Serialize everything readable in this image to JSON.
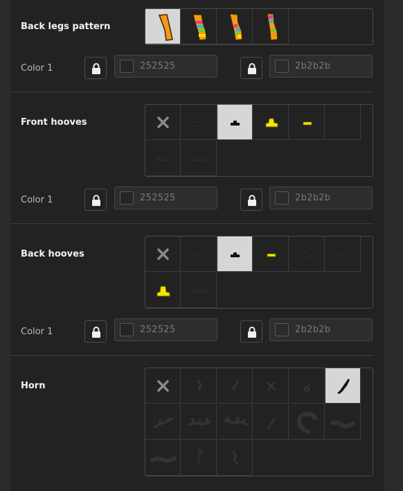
{
  "colors": {
    "accent_selected": "#d6d6d6",
    "panel_bg": "#222222",
    "page_bg": "#2b2b2b"
  },
  "sections": {
    "back_legs_pattern": {
      "label": "Back legs pattern",
      "options": [
        "solid-orange-leg-icon",
        "rainbow-stripe-leg-icon",
        "rainbow-patch-leg-icon",
        "rainbow-sock-leg-icon"
      ],
      "selected_index": 0,
      "color_label": "Color 1",
      "color_a": {
        "hex": "252525",
        "swatch": "#252525"
      },
      "color_b": {
        "hex": "2b2b2b",
        "swatch": "#2b2b2b"
      }
    },
    "front_hooves": {
      "label": "Front hooves",
      "options": [
        "none-x-icon",
        "hoof-style-1-icon",
        "hoof-style-2-icon",
        "golden-hoof-icon",
        "yellow-hoof-band-icon",
        "hoof-style-5-icon",
        "hoof-style-6-icon",
        "hoof-style-7-icon"
      ],
      "selected_index": 2,
      "color_label": "Color 1",
      "color_a": {
        "hex": "252525",
        "swatch": "#252525"
      },
      "color_b": {
        "hex": "2b2b2b",
        "swatch": "#2b2b2b"
      }
    },
    "back_hooves": {
      "label": "Back hooves",
      "options": [
        "none-x-icon",
        "hoof-style-1-icon",
        "hoof-style-2-icon",
        "yellow-hoof-band-icon",
        "hoof-style-4-icon",
        "hoof-style-5-icon",
        "golden-bell-hoof-icon",
        "hoof-style-7-icon"
      ],
      "selected_index": 2,
      "color_label": "Color 1",
      "color_a": {
        "hex": "252525",
        "swatch": "#252525"
      },
      "color_b": {
        "hex": "2b2b2b",
        "swatch": "#2b2b2b"
      }
    },
    "horn": {
      "label": "Horn",
      "options": [
        "none-x-icon",
        "horn-style-1-icon",
        "horn-style-2-icon",
        "horn-style-3-icon",
        "horn-style-4-icon",
        "unicorn-horn-icon",
        "antler-style-1-icon",
        "antler-style-2-icon",
        "antler-style-3-icon",
        "horn-style-9-icon",
        "curled-horn-icon",
        "wide-horn-icon",
        "mustache-horn-icon",
        "antenna-horn-icon",
        "horn-style-14-icon"
      ],
      "selected_index": 5
    }
  }
}
